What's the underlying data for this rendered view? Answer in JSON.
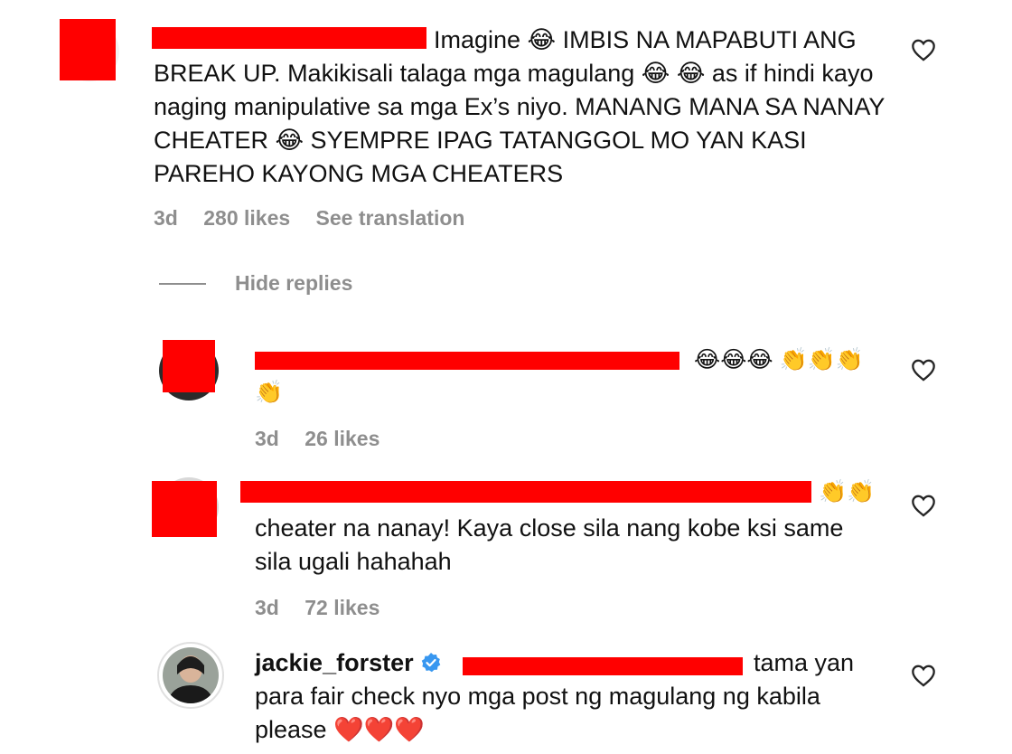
{
  "comments": [
    {
      "text_line1": "Imagine 😂 IMBIS NA MAPABUTI ANG",
      "text_rest": "BREAK UP. Makikisali talaga mga magulang 😂 😂 as if hindi kayo naging manipulative sa mga Ex’s niyo. MANANG MANA SA NANAY CHEATER 😂 SYEMPRE IPAG TATANGGOL MO YAN KASI PAREHO KAYONG MGA CHEATERS",
      "time": "3d",
      "likes": "280 likes",
      "see_translation": "See translation"
    }
  ],
  "hide_replies": "Hide replies",
  "replies": [
    {
      "emojis_line1": "😂😂😂 👏👏👏",
      "emojis_line2": "👏",
      "time": "3d",
      "likes": "26 likes"
    },
    {
      "emojis_line1": "👏👏",
      "text": "cheater na nanay! Kaya close sila nang kobe ksi same sila ugali hahahah",
      "time": "3d",
      "likes": "72 likes"
    },
    {
      "username": "jackie_forster",
      "text_line1": "tama yan",
      "text_rest": "para fair check nyo mga post ng magulang ng kabila please ❤️❤️❤️"
    }
  ],
  "colors": {
    "redaction": "#ff0000",
    "meta_gray": "#8e8e8e",
    "verified_blue": "#3897f0"
  }
}
